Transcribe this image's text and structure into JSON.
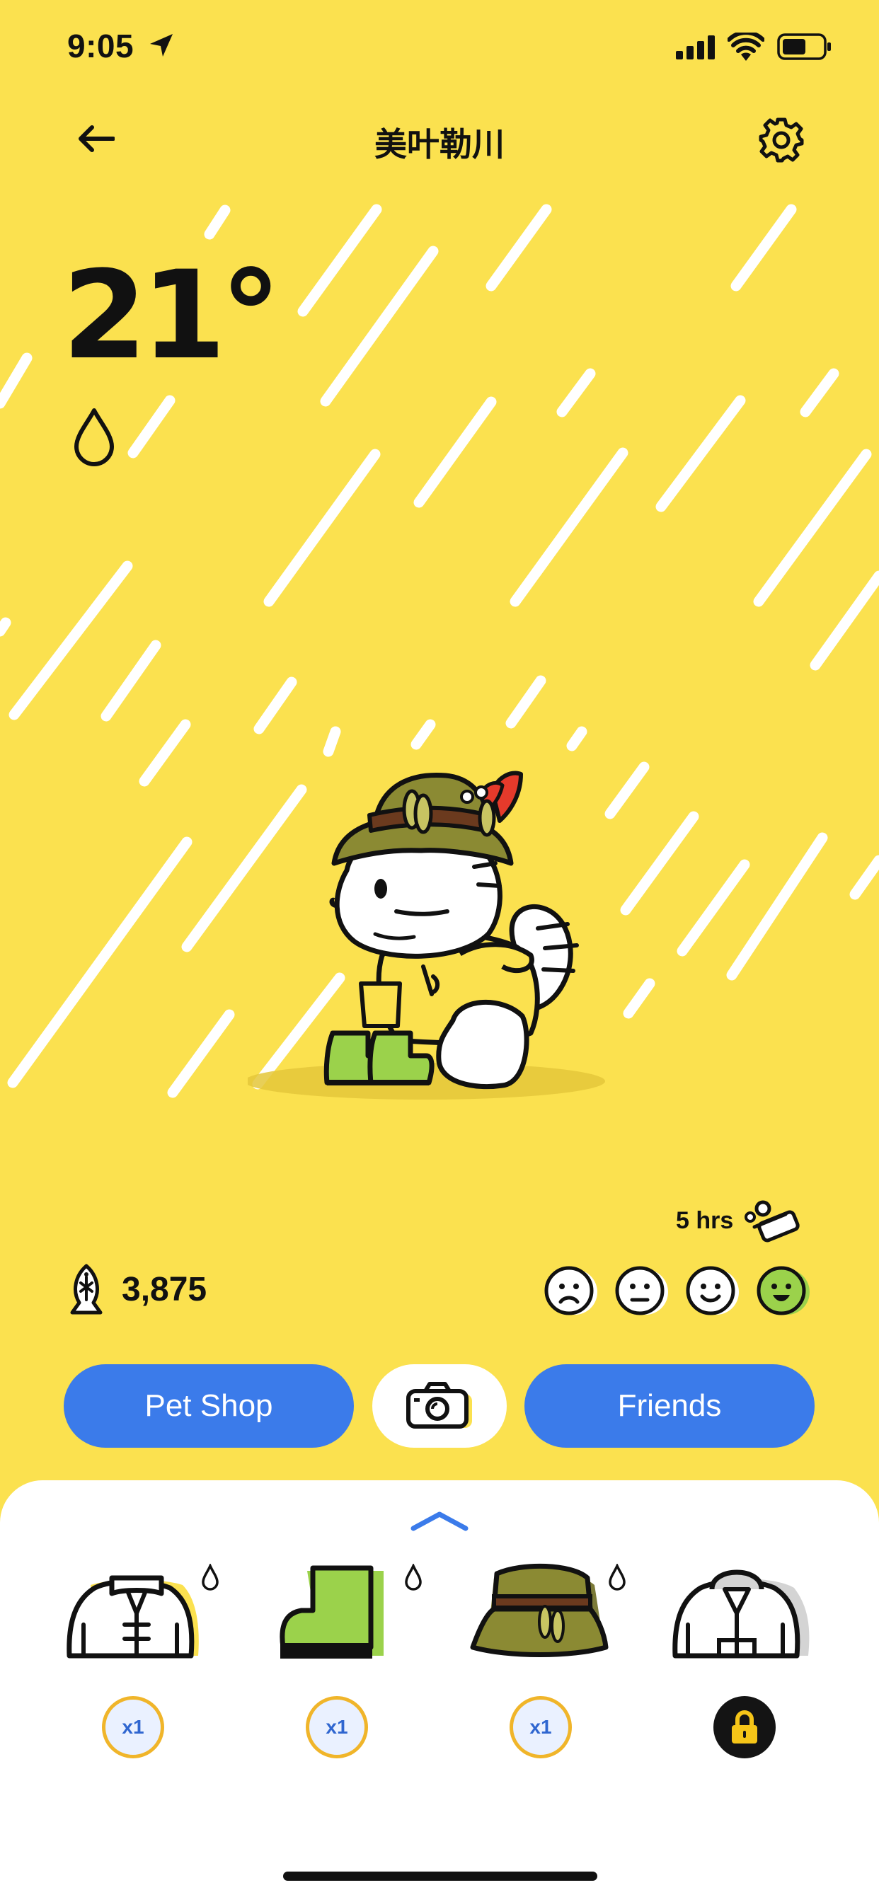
{
  "status_bar": {
    "time": "9:05"
  },
  "header": {
    "title": "美叶勒川"
  },
  "weather": {
    "temperature": "21°",
    "condition_icon": "raindrop-icon"
  },
  "pet": {
    "sleep_label": "5 hrs",
    "coins": "3,875",
    "mood_level": 4,
    "mood_levels_total": 4
  },
  "actions": {
    "pet_shop": "Pet Shop",
    "camera_icon": "camera-icon",
    "friends": "Friends"
  },
  "wardrobe": {
    "items": [
      {
        "name": "raincoat",
        "qty": "x1",
        "weather": "rain"
      },
      {
        "name": "rain-boots",
        "qty": "x1",
        "weather": "rain"
      },
      {
        "name": "bucket-hat",
        "qty": "x1",
        "weather": "rain"
      },
      {
        "name": "jacket",
        "locked": true
      }
    ]
  },
  "colors": {
    "background": "#FBE14F",
    "accent": "#3B7BEA",
    "mood_active": "#9BD24B",
    "badge_ring": "#F0B52A"
  }
}
